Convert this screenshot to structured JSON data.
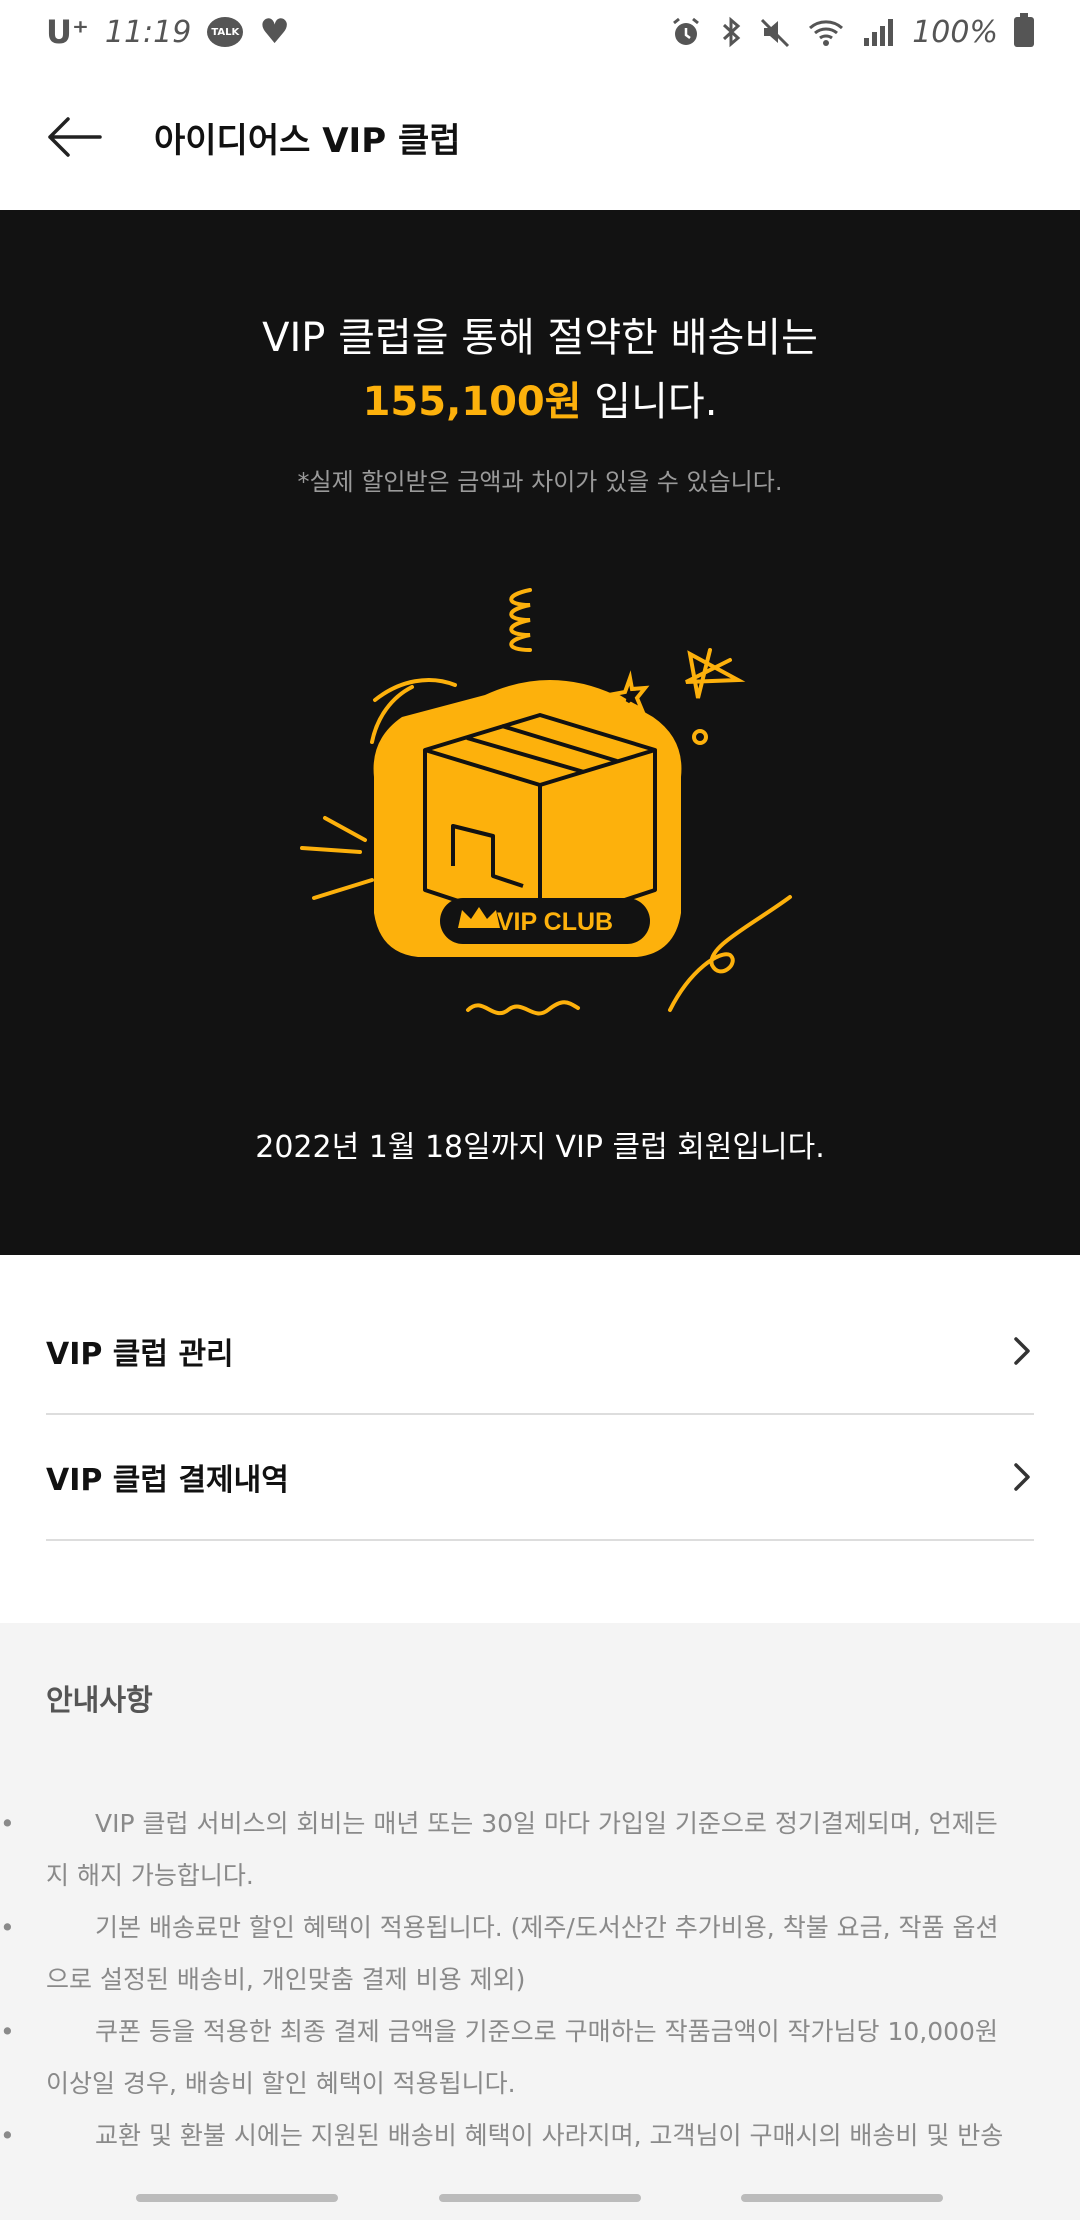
{
  "status_bar": {
    "carrier": "U⁺",
    "time": "11:19",
    "talk_badge": "TALK",
    "battery": "100%",
    "icons": [
      "talk-icon",
      "heart-icon",
      "alarm-icon",
      "bluetooth-icon",
      "mute-icon",
      "wifi-icon",
      "signal-icon",
      "battery-icon"
    ]
  },
  "app_bar": {
    "title": "아이디어스 VIP 클럽"
  },
  "hero": {
    "headline_line1": "VIP 클럽을 통해 절약한 배송비는",
    "amount": "155,100원",
    "headline_suffix": " 입니다.",
    "disclaimer": "*실제 할인받은 금액과 차이가 있을 수 있습니다.",
    "badge_label": "VIP CLUB",
    "membership_text": "2022년 1월 18일까지 VIP 클럽 회원입니다.",
    "accent_color": "#FDB10C",
    "background_color": "#121212"
  },
  "menu": {
    "manage": "VIP 클럽 관리",
    "history": "VIP 클럽 결제내역"
  },
  "notice": {
    "title": "안내사항",
    "items": [
      "VIP 클럽 서비스의 회비는 매년 또는 30일 마다 가입일 기준으로 정기결제되며, 언제든지 해지 가능합니다.",
      "기본 배송료만 할인 혜택이 적용됩니다. (제주/도서산간 추가비용, 착불 요금, 작품 옵션으로 설정된 배송비, 개인맞춤 결제 비용 제외)",
      "쿠폰 등을 적용한 최종 결제 금액을 기준으로 구매하는 작품금액이 작가님당 10,000원 이상일 경우, 배송비 할인 혜택이 적용됩니다.",
      "교환 및 환불 시에는 지원된 배송비 혜택이 사라지며, 고객님이 구매시의 배송비 및 반송"
    ]
  }
}
